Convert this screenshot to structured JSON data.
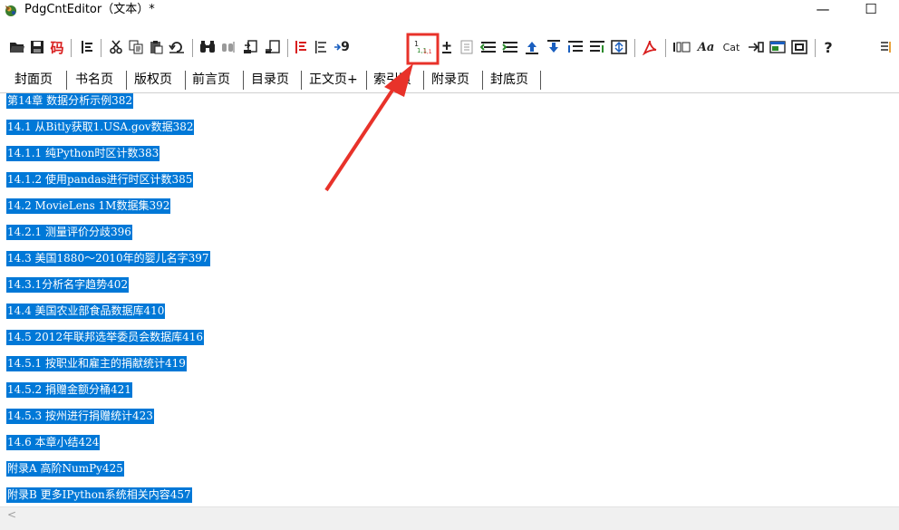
{
  "window": {
    "title": "PdgCntEditor（文本）*",
    "minimize": "—",
    "maximize": "☐"
  },
  "toolbar": {
    "code_label": "码",
    "number_label": "9",
    "font_label": "Aa",
    "cat_label": "Cat",
    "help_label": "?",
    "highlighted_button": "page-number-insert"
  },
  "tabs": [
    {
      "label": "封面页"
    },
    {
      "label": "书名页"
    },
    {
      "label": "版权页"
    },
    {
      "label": "前言页"
    },
    {
      "label": "目录页"
    },
    {
      "label": "正文页+"
    },
    {
      "label": "索引页"
    },
    {
      "label": "附录页"
    },
    {
      "label": "封底页"
    }
  ],
  "content": {
    "lines": [
      "第14章 数据分析示例382",
      "14.1 从Bitly获取1.USA.gov数据382",
      "14.1.1 纯Python时区计数383",
      "14.1.2 使用pandas进行时区计数385",
      "14.2 MovieLens 1M数据集392",
      "14.2.1 测量评价分歧396",
      "14.3 美国1880～2010年的婴儿名字397",
      "14.3.1分析名字趋势402",
      "14.4 美国农业部食品数据库410",
      "14.5 2012年联邦选举委员会数据库416",
      "14.5.1 按职业和雇主的捐献统计419",
      "14.5.2 捐赠金额分桶421",
      "14.5.3 按州进行捐赠统计423",
      "14.6 本章小结424",
      "附录A 高阶NumPy425",
      "附录B 更多IPython系统相关内容457"
    ],
    "selection_color": "#0078d7"
  },
  "scrollbar": {
    "left_arrow": "<"
  },
  "annotation": {
    "color": "#e8322a"
  }
}
